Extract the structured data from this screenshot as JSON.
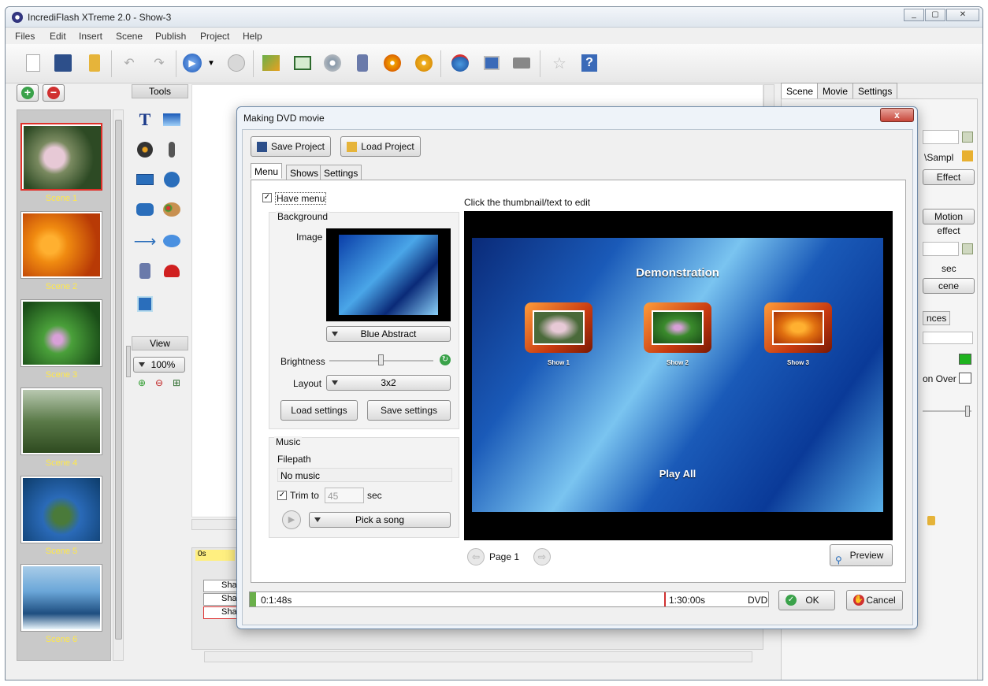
{
  "app": {
    "title": "IncrediFlash XTreme 2.0 - Show-3",
    "menu": [
      "Files",
      "Edit",
      "Insert",
      "Scene",
      "Publish",
      "Project",
      "Help"
    ]
  },
  "scenes": [
    {
      "label": "Scene 1",
      "colors": [
        "#3d5a30",
        "#e7c9d6"
      ]
    },
    {
      "label": "Scene 2",
      "colors": [
        "#f08a10",
        "#c03a06"
      ]
    },
    {
      "label": "Scene 3",
      "colors": [
        "#3c8a2c",
        "#1a4d18"
      ]
    },
    {
      "label": "Scene 4",
      "colors": [
        "#8fa88a",
        "#2e4a20"
      ]
    },
    {
      "label": "Scene 5",
      "colors": [
        "#2a6ab8",
        "#0d3c6a"
      ]
    },
    {
      "label": "Scene 6",
      "colors": [
        "#6aa6d8",
        "#1e4e80"
      ]
    }
  ],
  "tools_panel": {
    "title": "Tools",
    "view_title": "View",
    "zoom": "100%"
  },
  "timeline": {
    "start": "0s",
    "tracks": [
      "Shap",
      "Shap",
      "Shap"
    ]
  },
  "right_panel": {
    "tabs": [
      "Scene",
      "Movie",
      "Settings"
    ],
    "path_text": "\\Sampl",
    "effect_btn": "Effect",
    "motion_btn": "Motion effect",
    "sec": "sec",
    "scene_btn": "cene",
    "tab_partial": "nces",
    "rollover": "on Over"
  },
  "dialog": {
    "title": "Making DVD movie",
    "save_project": "Save Project",
    "load_project": "Load Project",
    "tabs": [
      "Menu",
      "Shows",
      "Settings"
    ],
    "have_menu": "Have menu",
    "background": "Background",
    "image_label": "Image",
    "bg_choice": "Blue Abstract",
    "brightness": "Brightness",
    "brightness_level": 0.5,
    "layout_label": "Layout",
    "layout_value": "3x2",
    "load_settings": "Load settings",
    "save_settings": "Save settings",
    "music": "Music",
    "filepath": "Filepath",
    "no_music": "No music",
    "trim_to": "Trim to",
    "trim_value": "45",
    "trim_unit": "sec",
    "pick_song": "Pick a song",
    "hint": "Click the thumbnail/text to edit",
    "preview_title": "Demonstration",
    "shows": [
      "Show 1",
      "Show 2",
      "Show 3"
    ],
    "play_all": "Play All",
    "page": "Page 1",
    "preview_btn": "Preview",
    "time_used": "0:1:48s",
    "time_total": "1:30:00s",
    "media": "DVD",
    "ok": "OK",
    "cancel": "Cancel",
    "close": "x"
  },
  "colors": {
    "accent": "#2a6ebb",
    "scene_label": "#ffe84a",
    "green": "#1fb31f"
  }
}
